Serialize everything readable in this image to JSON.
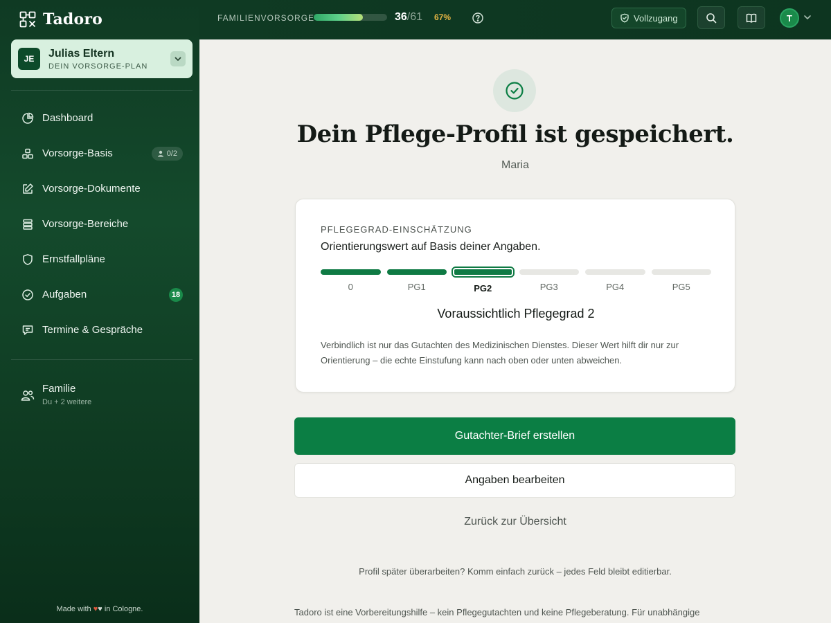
{
  "brand": {
    "name": "Tadoro"
  },
  "plan": {
    "avatar": "JE",
    "title": "Julias Eltern",
    "subtitle": "DEIN VORSORGE-PLAN"
  },
  "nav": {
    "items": [
      {
        "label": "Dashboard",
        "icon": "pie-chart-icon"
      },
      {
        "label": "Vorsorge-Basis",
        "icon": "blocks-icon",
        "badge": "0/2"
      },
      {
        "label": "Vorsorge-Dokumente",
        "icon": "edit-document-icon"
      },
      {
        "label": "Vorsorge-Bereiche",
        "icon": "stack-icon"
      },
      {
        "label": "Ernstfallpläne",
        "icon": "shield-icon"
      },
      {
        "label": "Aufgaben",
        "icon": "check-circle-icon",
        "badge": "18"
      },
      {
        "label": "Termine & Gespräche",
        "icon": "chat-icon"
      }
    ]
  },
  "family": {
    "title": "Familie",
    "subtitle": "Du + 2 weitere"
  },
  "footer": {
    "made_with_prefix": "Made with",
    "made_with_suffix": "in Cologne."
  },
  "topbar": {
    "progress_label": "FAMILIENVORSORGE",
    "progress_done": "36",
    "progress_total": "/61",
    "progress_percent_text": "67%",
    "progress_fraction": 0.67,
    "access_label": "Vollzugang",
    "user_initial": "T"
  },
  "main": {
    "headline": "Dein Pflege-Profil ist gespeichert.",
    "person": "Maria",
    "card": {
      "kicker": "PFLEGEGRAD-EINSCHÄTZUNG",
      "lead": "Orientierungswert auf Basis deiner Angaben.",
      "scale": [
        {
          "label": "0",
          "state": "filled"
        },
        {
          "label": "PG1",
          "state": "filled"
        },
        {
          "label": "PG2",
          "state": "current"
        },
        {
          "label": "PG3",
          "state": "empty"
        },
        {
          "label": "PG4",
          "state": "empty"
        },
        {
          "label": "PG5",
          "state": "empty"
        }
      ],
      "result": "Voraussichtlich Pflegegrad 2",
      "note": "Verbindlich ist nur das Gutachten des Medizinischen Dienstes. Dieser Wert hilft dir nur zur Orientierung – die echte Einstufung kann nach oben oder unten abweichen."
    },
    "primary_button": "Gutachter-Brief erstellen",
    "secondary_button": "Angaben bearbeiten",
    "back_link": "Zurück zur Übersicht",
    "hint": "Profil später überarbeiten? Komm einfach zurück – jedes Feld bleibt editierbar.",
    "disclaimer": "Tadoro ist eine Vorbereitungshilfe – kein Pflegegutachten und keine Pflegeberatung. Für unabhängige"
  },
  "colors": {
    "accent": "#0b7e44",
    "sidebar": "#0f3a23",
    "warning": "#e4b544"
  }
}
